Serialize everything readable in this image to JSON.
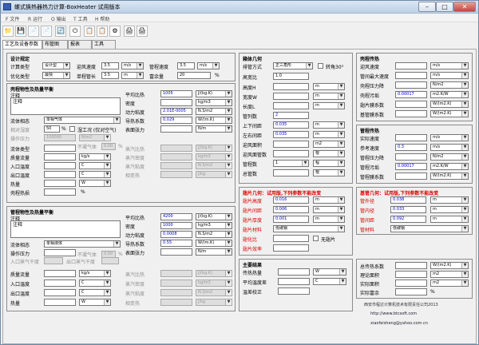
{
  "window": {
    "title": "螺式换热器热力计算-BoxHeater 试用版本",
    "min_label": "–",
    "max_label": "□",
    "close_label": "✕"
  },
  "menus": [
    "F 文件",
    "R 运行",
    "O 输出",
    "T 工具",
    "H 帮助"
  ],
  "toolbar": {
    "icons": [
      "📁",
      "💾",
      "📄",
      "📄",
      "🔄",
      "⏻",
      "📋",
      "📋",
      "⚙",
      "🖨",
      "🖨",
      "📊"
    ]
  },
  "tabs": [
    "工艺及设备参数",
    "布管图",
    "报表",
    "工具"
  ],
  "design": {
    "title": "设计规定",
    "calc_type_label": "计算类型",
    "calc_type": "设计型",
    "flow_speed_label": "迎风速度",
    "flow_speed": "3.5",
    "flow_speed_unit": "m/s",
    "tube_speed_label": "管程速度",
    "tube_speed": "3.5",
    "tube_speed_unit": "m/s",
    "opt_type_label": "优化类型",
    "opt_type": "最快",
    "single_len_label": "单程管长",
    "single_len": "3.5",
    "single_len_unit": "m",
    "margin_label": "富余量",
    "margin": "20",
    "margin_unit": "%"
  },
  "shell": {
    "title": "壳程物性及热量平衡",
    "note_label": "注释",
    "note": "注释",
    "avg_cp_label": "平均比热",
    "avg_cp": "1005",
    "avg_cp_unit": "J/(kg.K)",
    "density_label": "密度",
    "density_unit": "kg/m3",
    "viscosity_label": "动力粘度",
    "viscosity": "2.01E-0005",
    "viscosity_unit": "N.S/m2",
    "conductivity_label": "导热系数",
    "conductivity": "0.029",
    "conductivity_unit": "W/(m.K)",
    "surface_tension_label": "表面张力",
    "surface_tension_unit": "N/m",
    "medium_label": "流体相态",
    "medium": "单相气体",
    "rel_humidity_label": "相对湿度",
    "rel_humidity": "50",
    "rel_humidity_unit": "%",
    "wet_air_label": "湿工况 (仅对空气)",
    "pressure_label": "操作压力",
    "pressure": "100000",
    "pressure_unit": "N/m2",
    "flow_type_label": "流体类型",
    "flow_type_unit": "kg/s",
    "no_vapor_label": "不凝气体",
    "no_vapor_value": "0.00",
    "no_vapor_unit": "%",
    "mass_flow_label": "质量流量",
    "inlet_label": "入口温度",
    "outlet_label": "出口温度",
    "heat_label": "热量",
    "heat_unit": "W",
    "shell_eff_label": "壳程热损",
    "shell_eff_unit": "%",
    "temp_unit": "C",
    "vapor_cp_label": "蒸汽比热",
    "vapor_density_label": "蒸汽密度",
    "vapor_visc_label": "蒸汽粘度",
    "latent_label": "相变热",
    "vapor_cp_unit": "J/(kg.K)",
    "vapor_density_unit": "kg/m3",
    "vapor_visc_unit": "N.S/m2",
    "latent_unit": "J/kg"
  },
  "tube": {
    "title": "管程物性及热量平衡",
    "note_label": "注释",
    "note": "注释",
    "avg_cp_label": "平均比热",
    "avg_cp": "4200",
    "avg_cp_unit": "J/(kg.K)",
    "density_label": "密度",
    "density": "1000",
    "density_unit": "kg/m3",
    "viscosity_label": "动力粘度",
    "viscosity": "0.0008",
    "viscosity_unit": "N.S/m2",
    "conductivity_label": "导热系数",
    "conductivity": "0.55",
    "conductivity_unit": "W/(m.K)",
    "surface_tension_label": "表面张力",
    "surface_tension_unit": "N/m",
    "medium_label": "流体相态",
    "medium": "单相液体",
    "pressure_label": "操作压力",
    "pressure_unit": "N/m2",
    "no_vapor_label": "不凝气体",
    "no_vapor_value": "0.00",
    "no_vapor_unit": "%",
    "inlet_pressure_label": "入口蒸气干度",
    "inlet_pressure_unit": "",
    "outlet_pressure_label": "出口蒸气干度",
    "outlet_pressure_unit": "",
    "mass_flow_label": "质量流量",
    "mass_flow_unit": "kg/s",
    "inlet_label": "入口温度",
    "outlet_label": "出口温度",
    "heat_label": "热量",
    "heat_unit": "W",
    "temp_unit": "C",
    "vapor_cp_label": "蒸汽比热",
    "vapor_density_label": "蒸汽密度",
    "vapor_visc_label": "蒸汽粘度",
    "latent_label": "相变热",
    "vapor_cp_unit": "J/(kg.K)",
    "vapor_density_unit": "kg/m3",
    "vapor_visc_unit": "N.S/m2",
    "latent_unit": "J/kg"
  },
  "geometry": {
    "title": "箱体几何",
    "arrangement_label": "排管方式",
    "arrangement": "正三角形",
    "rotate_label": "转角30°",
    "aspect_label": "高宽比",
    "aspect": "1.0",
    "height_label": "高度H",
    "width_label": "宽度W",
    "length_label": "长度L",
    "tubes_per_row_label": "管列数",
    "tubes_per_row": "2",
    "vert_pitch_label": "上下间距",
    "vert_pitch": "0.035",
    "horiz_pitch_label": "左右间距",
    "horiz_pitch": "0.035",
    "front_area_label": "迎风面积",
    "front_area_unit": "m2",
    "frontal_rows_label": "迎风面管数",
    "frontal_rows_unit": "根",
    "passes_label": "管程数",
    "passes": "1",
    "passes_unit": "程",
    "total_tubes_label": "总管数",
    "total_tubes_unit": "根",
    "len_unit": "m",
    "mm_unit": "m"
  },
  "fin": {
    "title": "翅片几何：试用版,下列参数不能改变",
    "height_label": "翅片高度",
    "height": "0.016",
    "width_label": "翅片间距",
    "width": "0.006",
    "thick_label": "翅片厚度",
    "thick": "0.001",
    "material_label": "翅片材料",
    "material": "低碳钢",
    "ratio_label": "翅化比",
    "eff_label": "翅片效率",
    "no_fin_label": "无翅片",
    "unit": "m"
  },
  "results": {
    "title": "主要结果",
    "heat_label": "传热热量",
    "heat_unit": "W",
    "lmtd_label": "平均温度差",
    "lmtd_unit": "C",
    "temp_check_label": "温差校正"
  },
  "shell_heat": {
    "title": "壳程传热",
    "flow_speed_label": "迎风速度",
    "flow_speed_unit": "m/s",
    "fin_speed_label": "管间最大速度",
    "fin_speed_unit": "m/s",
    "pressure_drop_label": "壳程压力降",
    "pressure_drop_unit": "N/m2",
    "fouling_label": "壳程污垢",
    "fouling": "0.00017",
    "fouling_unit": "m2.K/W",
    "film_label": "翅片膜系数",
    "film_unit": "W/(m2.K)",
    "base_label": "基管膜系数",
    "base_unit": "W/(m2.K)"
  },
  "tube_heat": {
    "title": "管程传热",
    "actual_speed_label": "实际速度",
    "actual_speed_unit": "m/s",
    "ref_speed_label": "参考速度",
    "ref_speed": "0.3",
    "ref_speed_unit": "m/s",
    "pressure_drop_label": "管程压力降",
    "pressure_drop_unit": "N/m2",
    "fouling_label": "管程污垢",
    "fouling": "0.00017",
    "fouling_unit": "m2.K/W",
    "film_label": "管程膜系数",
    "film_unit": "W/(m2.K)"
  },
  "tube_geom": {
    "title": "基管几何：试用版,下列参数不能改变",
    "od_label": "管外径",
    "od": "0.038",
    "id_label": "管内径",
    "id": "0.033",
    "pitch_label": "管间距",
    "pitch": "0.092",
    "material_label": "管材料",
    "material": "低碳钢",
    "unit": "m"
  },
  "summary": {
    "total_label": "总传热系数",
    "total_unit": "W/(m2.K)",
    "theory_area_label": "理论面积",
    "theory_area_unit": "m2",
    "actual_area_label": "实际面积",
    "actual_area_unit": "m2",
    "actual_margin_label": "实际富余",
    "actual_margin_unit": "%"
  },
  "footer": {
    "company": "西安市程达计算机技术有限责任公司2013",
    "site": "http://www.btcsoft.com",
    "email": "xiaofeisheng@yahoo.com.cn"
  }
}
